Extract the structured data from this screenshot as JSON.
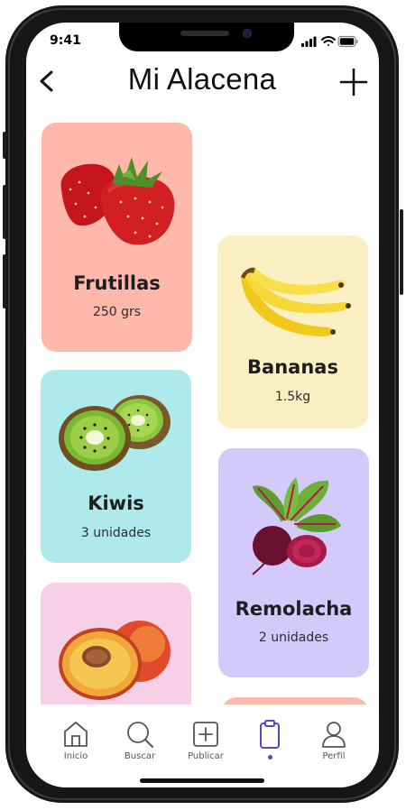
{
  "status_bar": {
    "time": "9:41"
  },
  "header": {
    "title": "Mi Alacena",
    "back_icon": "chevron-left-icon",
    "add_icon": "plus-icon"
  },
  "items": [
    {
      "name": "Frutillas",
      "quantity": "250 grs",
      "color": "#FFB8A9",
      "icon": "strawberry-icon"
    },
    {
      "name": "Bananas",
      "quantity": "1.5kg",
      "color": "#FAF0C3",
      "icon": "banana-icon"
    },
    {
      "name": "Kiwis",
      "quantity": "3 unidades",
      "color": "#AEE9EB",
      "icon": "kiwi-icon"
    },
    {
      "name": "Remolacha",
      "quantity": "2 unidades",
      "color": "#D3CAFB",
      "icon": "beet-icon"
    },
    {
      "name": "",
      "quantity": "",
      "color": "#F7CFE6",
      "icon": "peach-icon"
    },
    {
      "name": "",
      "quantity": "",
      "color": "#FFB8A9",
      "icon": ""
    }
  ],
  "tabbar": {
    "active_color": "#5B44C9",
    "items": [
      {
        "label": "Inicio",
        "icon": "home-icon"
      },
      {
        "label": "Buscar",
        "icon": "search-icon"
      },
      {
        "label": "Publicar",
        "icon": "plus-square-icon"
      },
      {
        "label": "",
        "icon": "clipboard-icon",
        "active": true
      },
      {
        "label": "Perfil",
        "icon": "user-icon"
      }
    ]
  }
}
